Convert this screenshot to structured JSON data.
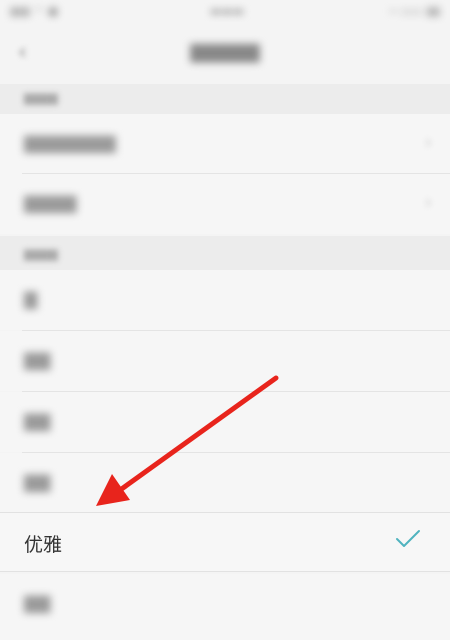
{
  "selected_option": {
    "label": "优雅",
    "checked": true
  },
  "colors": {
    "check_mark": "#4fb3bf",
    "annotation_arrow": "#e8241c",
    "background": "#f4f4f4"
  },
  "icons": {
    "back": "back-icon",
    "check": "check-icon",
    "chevron": "chevron-right-icon",
    "annotation": "annotation-arrow"
  }
}
